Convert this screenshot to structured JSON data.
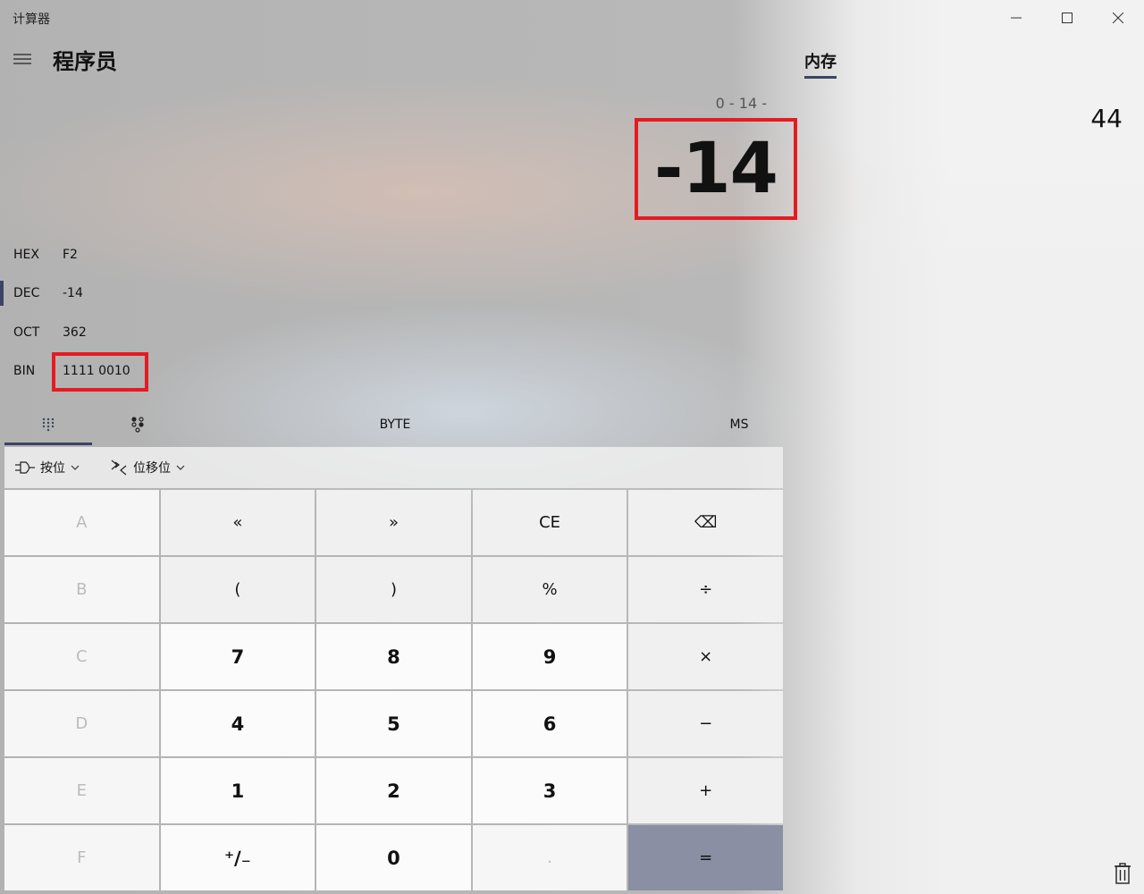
{
  "window": {
    "title": "计算器"
  },
  "header": {
    "mode_title": "程序员",
    "memory_tab": "内存"
  },
  "display": {
    "expression": "0 - 14 -",
    "result": "-14"
  },
  "radix": [
    {
      "label": "HEX",
      "value": "F2"
    },
    {
      "label": "DEC",
      "value": "-14",
      "active": true
    },
    {
      "label": "OCT",
      "value": "362"
    },
    {
      "label": "BIN",
      "value": "1111 0010"
    }
  ],
  "toolbar": {
    "word_size": "BYTE",
    "memory_store": "MS"
  },
  "operators": {
    "bitwise": "按位",
    "bitshift": "位移位"
  },
  "memory": {
    "items": [
      "44"
    ]
  },
  "keys": [
    [
      "A",
      "«",
      "»",
      "CE",
      "⌫"
    ],
    [
      "B",
      "(",
      ")",
      "%",
      "÷"
    ],
    [
      "C",
      "7",
      "8",
      "9",
      "×"
    ],
    [
      "D",
      "4",
      "5",
      "6",
      "−"
    ],
    [
      "E",
      "1",
      "2",
      "3",
      "+"
    ],
    [
      "F",
      "⁺∕₋",
      "0",
      ".",
      "="
    ]
  ],
  "colors": {
    "accent": "#3c4463",
    "highlight": "#e41b23",
    "equals_bg": "#8a8fa3"
  }
}
